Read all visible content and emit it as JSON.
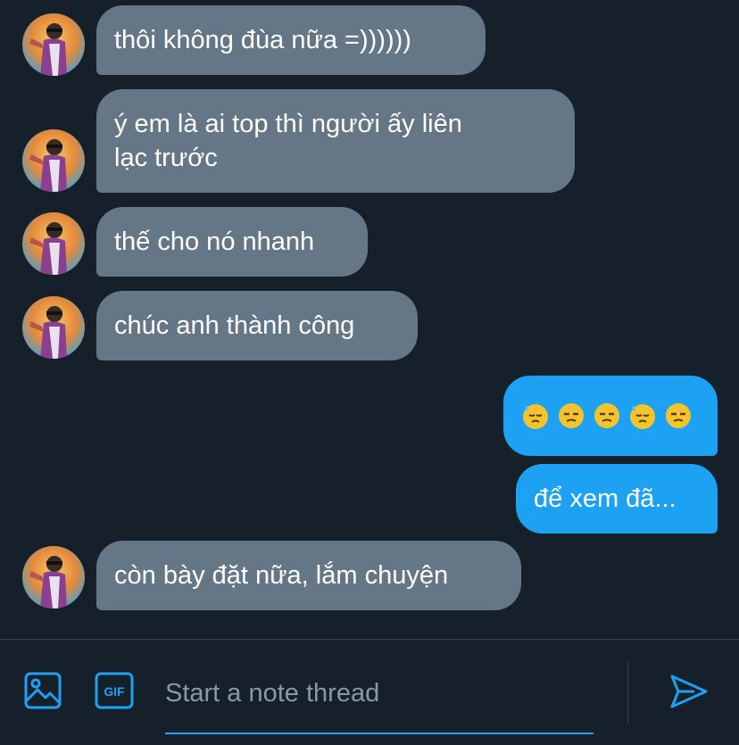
{
  "colors": {
    "background": "#15202b",
    "incoming_bubble": "#657786",
    "outgoing_bubble": "#1da1f2",
    "accent": "#1da1f2",
    "placeholder": "#8899a6",
    "divider": "#38444d"
  },
  "messages": [
    {
      "direction": "in",
      "text": "thôi không đùa nữa =))))))",
      "avatar": "avatar-photo"
    },
    {
      "direction": "in",
      "text": "ý em là ai top thì người ấy liên\nlạc trước",
      "avatar": "avatar-photo"
    },
    {
      "direction": "in",
      "text": "thế cho nó nhanh",
      "avatar": "avatar-photo"
    },
    {
      "direction": "in",
      "text": "chúc anh thành công",
      "avatar": "avatar-photo"
    },
    {
      "direction": "out",
      "emoji": [
        "downcast-face-with-sweat",
        "unamused-face",
        "unamused-face",
        "downcast-face-with-sweat",
        "unamused-face"
      ]
    },
    {
      "direction": "out",
      "text": "để xem đã..."
    },
    {
      "direction": "in",
      "text": "còn bày đặt nữa, lắm chuyện",
      "avatar": "avatar-photo"
    }
  ],
  "composer": {
    "placeholder": "Start a note thread",
    "value": "",
    "media_icon": "image-icon",
    "gif_icon": "gif-icon",
    "gif_label": "GIF",
    "send_icon": "send-icon"
  }
}
